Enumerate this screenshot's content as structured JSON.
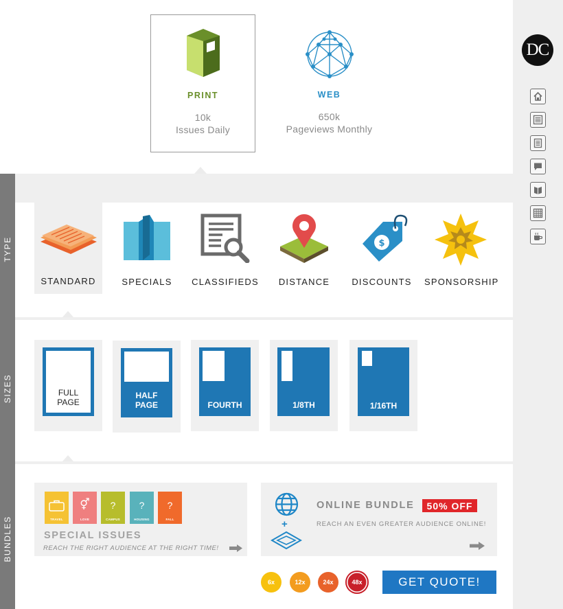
{
  "sidebar": {
    "logo": "DC",
    "nav": [
      {
        "icon": "home-icon"
      },
      {
        "icon": "newspaper-icon"
      },
      {
        "icon": "document-icon"
      },
      {
        "icon": "chat-icon"
      },
      {
        "icon": "book-icon"
      },
      {
        "icon": "calendar-icon"
      },
      {
        "icon": "coffee-icon"
      }
    ]
  },
  "platforms": {
    "print": {
      "title": "PRINT",
      "value": "10k",
      "subtitle": "Issues Daily",
      "color": "#6a8f2a"
    },
    "web": {
      "title": "WEB",
      "value": "650k",
      "subtitle": "Pageviews Monthly",
      "color": "#2a8fc7"
    }
  },
  "sections": {
    "type": "TYPE",
    "sizes": "SIZES",
    "bundles": "BUNDLES"
  },
  "types": [
    {
      "label": "STANDARD",
      "icon": "newspaper-stack-icon"
    },
    {
      "label": "SPECIALS",
      "icon": "folded-map-icon"
    },
    {
      "label": "CLASSIFIEDS",
      "icon": "magnifier-document-icon"
    },
    {
      "label": "DISTANCE",
      "icon": "map-pin-icon"
    },
    {
      "label": "DISCOUNTS",
      "icon": "price-tag-icon"
    },
    {
      "label": "SPONSORSHIP",
      "icon": "starburst-icon"
    }
  ],
  "sizes": [
    {
      "label_line1": "FULL",
      "label_line2": "PAGE"
    },
    {
      "label_line1": "HALF",
      "label_line2": "PAGE"
    },
    {
      "label_line1": "FOURTH",
      "label_line2": ""
    },
    {
      "label_line1": "1/8TH",
      "label_line2": ""
    },
    {
      "label_line1": "1/16TH",
      "label_line2": ""
    }
  ],
  "bundles": {
    "special": {
      "title": "SPECIAL ISSUES",
      "tagline": "REACH THE RIGHT AUDIENCE AT THE RIGHT TIME!",
      "issues": [
        {
          "name": "TRAVEL",
          "glyph": "",
          "color": "#f5c234"
        },
        {
          "name": "LOVE",
          "glyph": "⚥",
          "color": "#ef7f7f"
        },
        {
          "name": "CAMPUS",
          "glyph": "?",
          "color": "#b7bd2c"
        },
        {
          "name": "HOUSING",
          "glyph": "?",
          "color": "#59b2bb"
        },
        {
          "name": "FALL",
          "glyph": "?",
          "color": "#f06a2b"
        }
      ]
    },
    "online": {
      "title": "ONLINE BUNDLE",
      "badge": "50% OFF",
      "tagline": "REACH AN EVEN GREATER AUDIENCE ONLINE!",
      "plus": "+"
    }
  },
  "quantities": [
    {
      "label": "6x",
      "color": "#f7c10e"
    },
    {
      "label": "12x",
      "color": "#f39c1f"
    },
    {
      "label": "24x",
      "color": "#e8622b"
    },
    {
      "label": "48x",
      "color": "#c8202a"
    }
  ],
  "cta": {
    "label": "GET QUOTE!"
  }
}
